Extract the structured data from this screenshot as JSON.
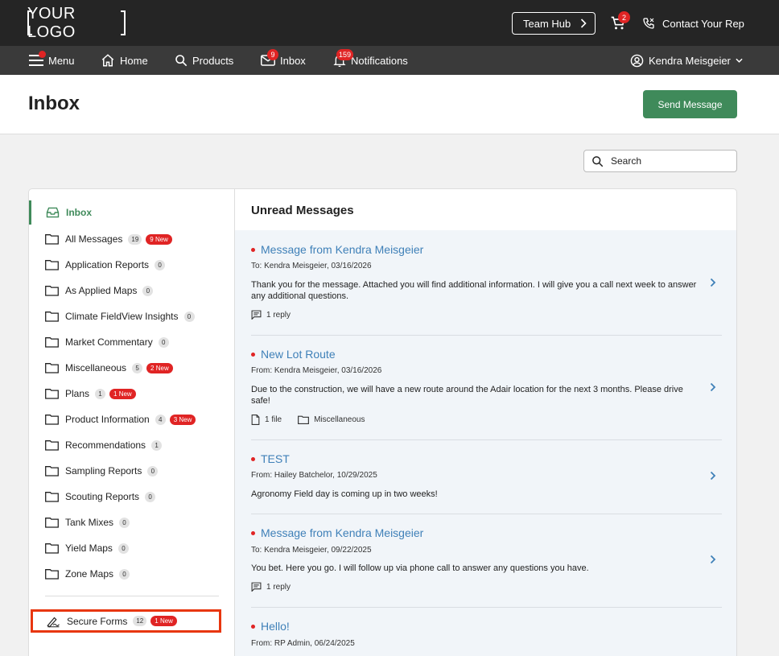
{
  "topbar": {
    "logo": "YOUR LOGO",
    "team_hub": "Team Hub",
    "cart_count": "2",
    "contact": "Contact Your Rep"
  },
  "nav": {
    "menu": "Menu",
    "home": "Home",
    "products": "Products",
    "inbox": "Inbox",
    "inbox_count": "9",
    "notifications": "Notifications",
    "notifications_count": "159",
    "user": "Kendra Meisgeier"
  },
  "header": {
    "title": "Inbox",
    "send_button": "Send Message"
  },
  "search": {
    "placeholder": "Search"
  },
  "sidebar": {
    "active": "Inbox",
    "items": [
      {
        "label": "All Messages",
        "count": "19",
        "new": "9 New"
      },
      {
        "label": "Application Reports",
        "count": "0",
        "new": ""
      },
      {
        "label": "As Applied Maps",
        "count": "0",
        "new": ""
      },
      {
        "label": "Climate FieldView Insights",
        "count": "0",
        "new": ""
      },
      {
        "label": "Market Commentary",
        "count": "0",
        "new": ""
      },
      {
        "label": "Miscellaneous",
        "count": "5",
        "new": "2 New"
      },
      {
        "label": "Plans",
        "count": "1",
        "new": "1 New"
      },
      {
        "label": "Product Information",
        "count": "4",
        "new": "3 New"
      },
      {
        "label": "Recommendations",
        "count": "1",
        "new": ""
      },
      {
        "label": "Sampling Reports",
        "count": "0",
        "new": ""
      },
      {
        "label": "Scouting Reports",
        "count": "0",
        "new": ""
      },
      {
        "label": "Tank Mixes",
        "count": "0",
        "new": ""
      },
      {
        "label": "Yield Maps",
        "count": "0",
        "new": ""
      },
      {
        "label": "Zone Maps",
        "count": "0",
        "new": ""
      }
    ],
    "secure_forms": {
      "label": "Secure Forms",
      "count": "12",
      "new": "1 New"
    }
  },
  "main": {
    "title": "Unread Messages",
    "messages": [
      {
        "title": "Message from Kendra Meisgeier",
        "meta": "To: Kendra Meisgeier, 03/16/2026",
        "body": "Thank you for the message. Attached you will find additional information. I will give you a call next week to answer any additional questions.",
        "reply": "1 reply"
      },
      {
        "title": "New Lot Route",
        "meta": "From: Kendra Meisgeier, 03/16/2026",
        "body": "Due to the construction, we will have a new route around the Adair location for the next 3 months. Please drive safe!",
        "files": "1 file",
        "folder": "Miscellaneous"
      },
      {
        "title": "TEST",
        "meta": "From: Hailey Batchelor, 10/29/2025",
        "body": "Agronomy Field day is coming up in two weeks!"
      },
      {
        "title": "Message from Kendra Meisgeier",
        "meta": "To: Kendra Meisgeier, 09/22/2025",
        "body": "You bet. Here you go. I will follow up via phone call to answer any questions you have.",
        "reply": "1 reply"
      },
      {
        "title": "Hello!",
        "meta": "From: RP Admin, 06/24/2025"
      }
    ]
  }
}
